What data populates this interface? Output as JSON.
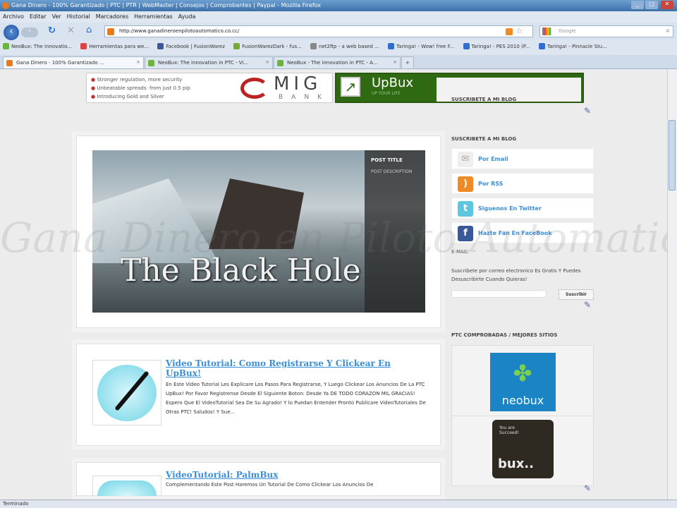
{
  "window": {
    "title": "Gana Dinero - 100% Garantizado | PTC | PTR | WebMaster | Consejos | Comprobantes | Paypal - Mozilla Firefox"
  },
  "menu": [
    "Archivo",
    "Editar",
    "Ver",
    "Historial",
    "Marcadores",
    "Herramientas",
    "Ayuda"
  ],
  "nav": {
    "url": "http://www.ganadineroenpilotoautomatico.co.cc/",
    "search_placeholder": "Google"
  },
  "bookmarks": [
    {
      "label": "NeoBux: The innovatio...",
      "color": "#6cb33f"
    },
    {
      "label": "Herramientas para we...",
      "color": "#d44"
    },
    {
      "label": "Facebook | FusionWarez",
      "color": "#3b5998"
    },
    {
      "label": "FusionWarezDark - fus...",
      "color": "#7a3"
    },
    {
      "label": "net2ftp - a web based ...",
      "color": "#888"
    },
    {
      "label": "Taringa! - Wow! free F...",
      "color": "#2f6dd0"
    },
    {
      "label": "Taringa! - PES 2010 (P...",
      "color": "#2f6dd0"
    },
    {
      "label": "Taringa! - Pinnacle Stu...",
      "color": "#2f6dd0"
    }
  ],
  "tabs": [
    {
      "label": "Gana Dinero - 100% Garantizado ...",
      "active": true,
      "color": "#e87a1c"
    },
    {
      "label": "NeoBux: The innovation in PTC - Vi...",
      "active": false,
      "color": "#6cb33f"
    },
    {
      "label": "NeoBux - The innovation in PTC - A...",
      "active": false,
      "color": "#6cb33f"
    }
  ],
  "ads": {
    "mig_bullets": [
      "Stronger regulation, more security",
      "Unbeatable spreads: from just 0.5 pip",
      "Introducing Gold and Silver"
    ],
    "mig_logo": "MIG",
    "mig_sub": "BANK",
    "upbux": "UpBux",
    "upbux_tag": "UP YOUR LIFE"
  },
  "watermark": "Gana Dinero en Piloto Automatico...",
  "featured": {
    "image_title": "The Black Hole",
    "post_title": "POST TITLE",
    "post_desc": "POST DESCRIPTION"
  },
  "posts": [
    {
      "title": "Video Tutorial: Como Registrarse Y Clickear En UpBux!",
      "excerpt": "En Este Video Tutorial Les Explicare Los Pasos Para Registrarse, Y Luego Clickear Los Anuncios De La PTC UpBux! Por Favor Registrense Desde El Siguiente Boton: Desde Ya DE TODO CORAZON MIL GRACIAS! Espero Que El VideoTutorial Sea De Su Agrado! Y lo Puedan Entender Pronto Publicare VideoTutoriales De Otras PTC! Saludos! Y Sue..."
    },
    {
      "title": "VideoTutorial: PalmBux",
      "excerpt": "Complementando Este Post Haremos Un Tutorial De Como Clickear Los Anuncios De"
    }
  ],
  "sidebar": {
    "subscribe_title_top": "SUSCRIBETE A MI BLOG",
    "subscribe_title": "SUSCRIBETE A MI BLOG",
    "items": [
      {
        "label": "Por Email"
      },
      {
        "label": "Por RSS"
      },
      {
        "label": "Siguenos En Twitter"
      },
      {
        "label": "Hazte Fan En FaceBook"
      }
    ],
    "email_title": "E-MAIL",
    "email_text": "Suscribete por correo electronico Es Gratis Y Puedes Desuscribirte Cuando Quieras!",
    "email_value": "",
    "subscribe_button": "Suscribir",
    "ptc_title": "PTC COMPROBADAS / MEJORES SITIOS",
    "ptc": [
      {
        "label": "neobux"
      },
      {
        "label": "bux.."
      }
    ],
    "bux_small": "You are Succeed!"
  },
  "status": "Terminado"
}
